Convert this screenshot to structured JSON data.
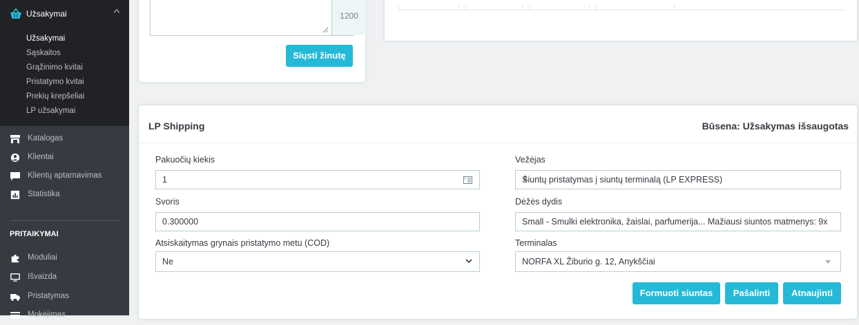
{
  "sidebar": {
    "orders_section": {
      "label": "Užsakymai",
      "submenu": [
        "Užsakymai",
        "Sąskaitos",
        "Grąžinimo kvitai",
        "Pristatymo kvitai",
        "Prekių krepšeliai",
        "LP užsakymai"
      ]
    },
    "items": [
      {
        "label": "Katalogas",
        "icon": "store-icon"
      },
      {
        "label": "Klientai",
        "icon": "user-circle-icon"
      },
      {
        "label": "Klientų aptarnavimas",
        "icon": "chat-icon"
      },
      {
        "label": "Statistika",
        "icon": "bar-chart-icon"
      }
    ],
    "section_title": "PRITAIKYMAI",
    "items2": [
      {
        "label": "Moduliai",
        "icon": "puzzle-icon"
      },
      {
        "label": "Išvaizda",
        "icon": "monitor-icon"
      },
      {
        "label": "Pristatymas",
        "icon": "truck-icon"
      },
      {
        "label": "Mokėjimas",
        "icon": "card-icon"
      }
    ]
  },
  "message": {
    "counter": "1200",
    "send_label": "Siųsti žinutę"
  },
  "shipping": {
    "title": "LP Shipping",
    "status": "Būsena: Užsakymas išsaugotas",
    "packages_label": "Pakuočių kiekis",
    "packages_value": "1",
    "weight_label": "Svoris",
    "weight_value": "0.300000",
    "cod_label": "Atsiskaitymas grynais pristatymo metu (COD)",
    "cod_value": "Ne",
    "carrier_label": "Vežėjas",
    "carrier_value": "Siuntų pristatymas į siuntų terminalą (LP EXPRESS)",
    "box_label": "Dėžės dydis",
    "box_value": "Small - Smulki elektronika, žaislai, parfumerija... Mažiausi siuntos matmenys: 9x",
    "terminal_label": "Terminalas",
    "terminal_value": "NORFA XL Žiburio g. 12, Anykščiai",
    "btn_form": "Formuoti siuntas",
    "btn_delete": "Pašalinti",
    "btn_update": "Atnaujinti"
  },
  "colors": {
    "accent": "#25b9d7",
    "sidebar": "#363a41",
    "sidebar_active": "#202226"
  }
}
